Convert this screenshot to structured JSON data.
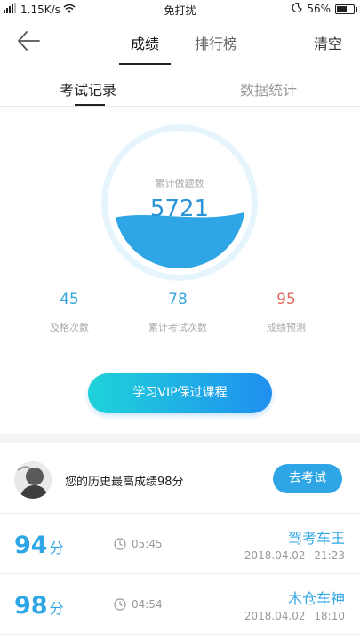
{
  "status_bar": {
    "network_speed": "1.15K/s",
    "center_text": "免打扰",
    "battery": "56%"
  },
  "nav": {
    "tabs": [
      {
        "label": "成绩",
        "active": true
      },
      {
        "label": "排行榜",
        "active": false
      }
    ],
    "clear_label": "清空"
  },
  "subtabs": [
    {
      "label": "考试记录",
      "active": true
    },
    {
      "label": "数据统计",
      "active": false
    }
  ],
  "gauge": {
    "caption": "累计做题数",
    "value": "5721",
    "fill_fraction": 0.4
  },
  "stats": [
    {
      "value": "45",
      "label": "及格次数",
      "color": "#35a6dc"
    },
    {
      "value": "78",
      "label": "累计考试次数",
      "color": "#35a6dc"
    },
    {
      "value": "95",
      "label": "成绩预测",
      "color": "#e46a5f"
    }
  ],
  "vip_button": "学习VIP保过课程",
  "best": {
    "text": "您的历史最高成绩98分",
    "button": "去考试"
  },
  "records": [
    {
      "score": "94",
      "unit": "分",
      "duration": "05:45",
      "title": "驾考车王",
      "date": "2018.04.02",
      "time": "21:23"
    },
    {
      "score": "98",
      "unit": "分",
      "duration": "04:54",
      "title": "木仓车神",
      "date": "2018.04.02",
      "time": "18:10"
    }
  ],
  "colors": {
    "accent": "#2ea6e5",
    "gauge_value": "#2b93d6",
    "predict_red": "#e46a5f"
  }
}
